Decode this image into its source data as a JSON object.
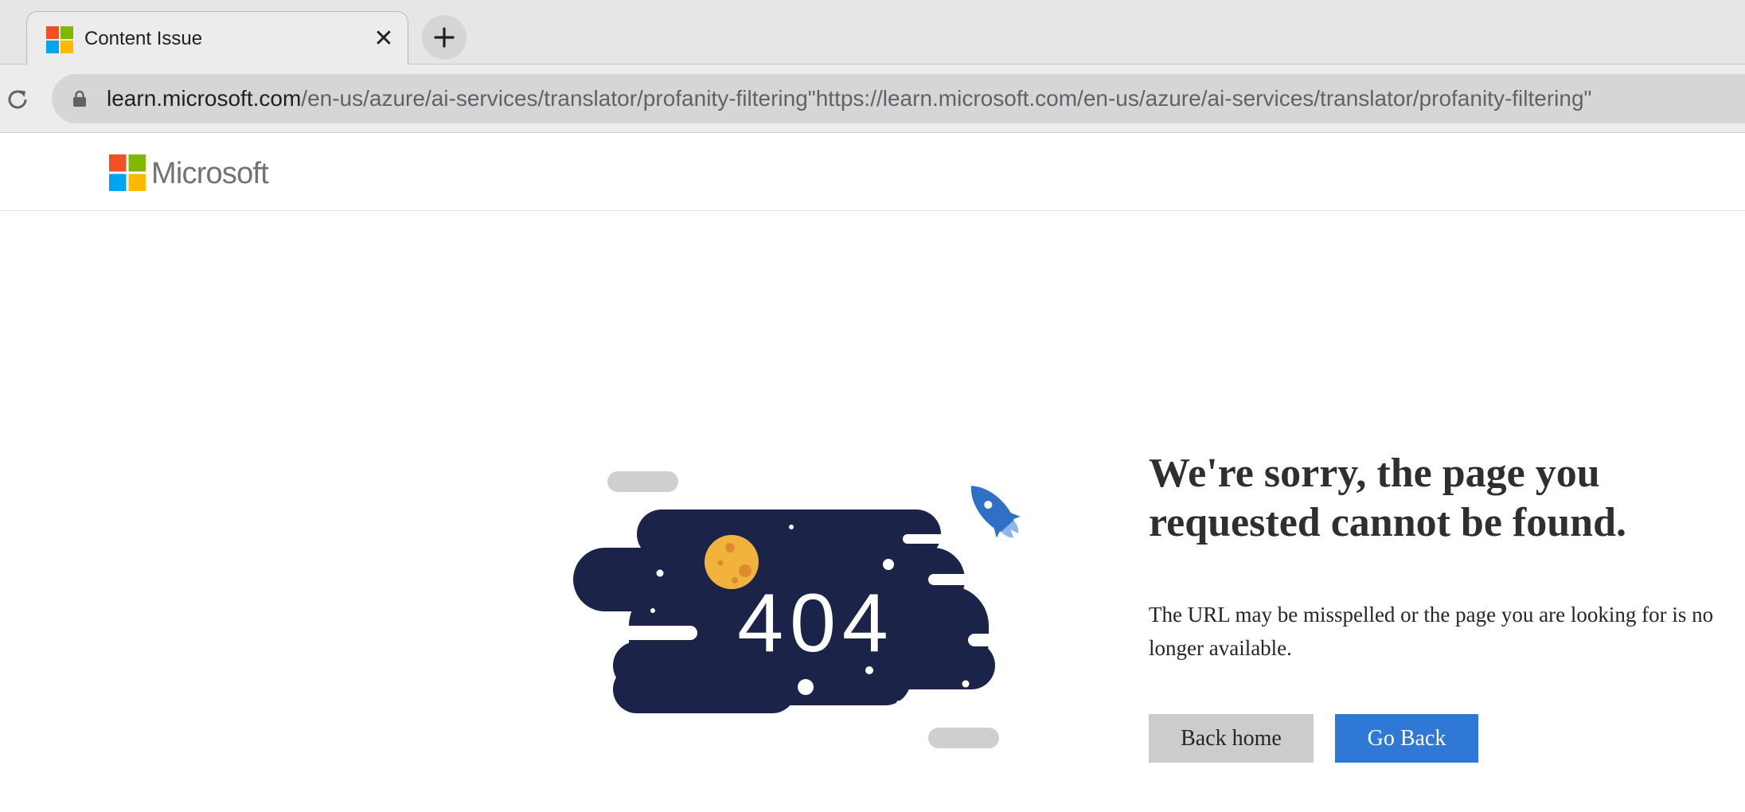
{
  "browser": {
    "tab": {
      "title": "Content Issue",
      "close_glyph": "✕",
      "favicon": "microsoft-logo-icon"
    },
    "new_tab_icon": "plus-icon",
    "reload_icon": "reload-icon",
    "lock_icon": "lock-icon",
    "address": {
      "host": "learn.microsoft.com",
      "rest": "/en-us/azure/ai-services/translator/profanity-filtering\"https://learn.microsoft.com/en-us/azure/ai-services/translator/profanity-filtering\""
    }
  },
  "header": {
    "brand": "Microsoft",
    "logo_colors": [
      "#f25022",
      "#7fba00",
      "#00a4ef",
      "#ffb900"
    ]
  },
  "error": {
    "code": "404",
    "title": "We're sorry, the page you requested cannot be found.",
    "message": "The URL may be misspelled or the page you are looking for is no longer available.",
    "back_home_label": "Back home",
    "go_back_label": "Go Back"
  },
  "colors": {
    "accent_button": "#2f78d6",
    "secondary_button": "#cccccc",
    "space_cloud": "#1b2349",
    "moon": "#f2b33d",
    "rocket": "#2f6fc4"
  }
}
